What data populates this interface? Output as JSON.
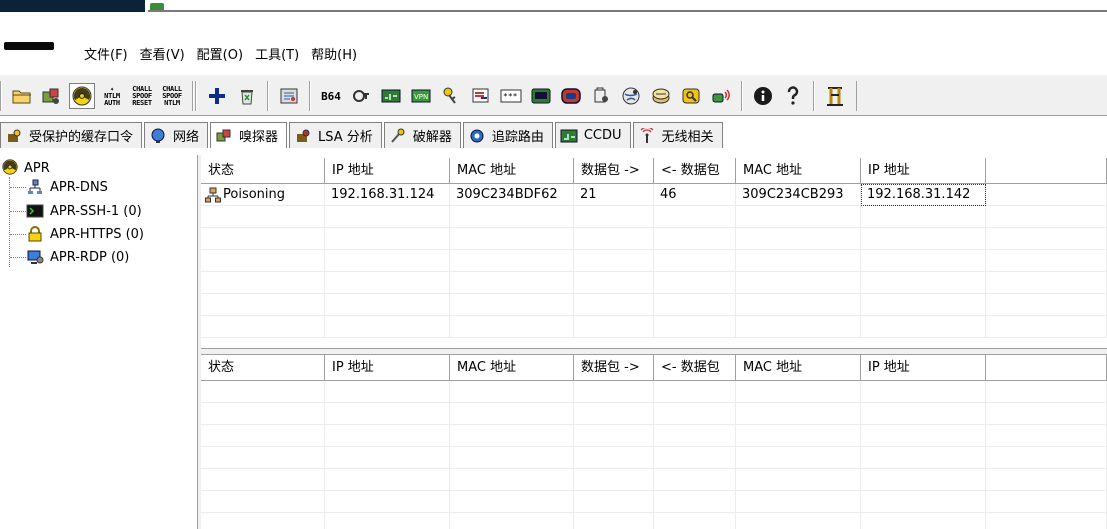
{
  "menu": {
    "items": [
      {
        "label": "文件(F)"
      },
      {
        "label": "查看(V)"
      },
      {
        "label": "配置(O)"
      },
      {
        "label": "工具(T)"
      },
      {
        "label": "帮助(H)"
      }
    ]
  },
  "toolbar": {
    "ntlm_auth": [
      "NTLM",
      "AUTH"
    ],
    "chall_spoof_reset": [
      "CHALL",
      "SPOOF",
      "RESET"
    ],
    "chall_spoof_ntlm": [
      "CHALL",
      "SPOOF",
      "NTLM"
    ],
    "b64": "B64"
  },
  "tabs": [
    {
      "label": "受保护的缓存口令",
      "icon": "key-icon"
    },
    {
      "label": "网络",
      "icon": "network-icon"
    },
    {
      "label": "嗅探器",
      "icon": "sniffer-icon",
      "active": true
    },
    {
      "label": "LSA 分析",
      "icon": "lsa-icon"
    },
    {
      "label": "破解器",
      "icon": "cracker-icon"
    },
    {
      "label": "追踪路由",
      "icon": "traceroute-icon"
    },
    {
      "label": "CCDU",
      "icon": "ccdu-icon"
    },
    {
      "label": "无线相关",
      "icon": "wireless-icon"
    }
  ],
  "tree": {
    "root": "APR",
    "children": [
      {
        "label": "APR-DNS",
        "icon": "dns-icon"
      },
      {
        "label": "APR-SSH-1 (0)",
        "icon": "terminal-icon"
      },
      {
        "label": "APR-HTTPS (0)",
        "icon": "lock-icon"
      },
      {
        "label": "APR-RDP (0)",
        "icon": "rdp-icon"
      }
    ]
  },
  "grid_top": {
    "columns": [
      "状态",
      "IP 地址",
      "MAC 地址",
      "数据包 ->",
      "<- 数据包",
      "MAC 地址",
      "IP 地址"
    ],
    "rows": [
      {
        "status": "Poisoning",
        "ip1": "192.168.31.124",
        "mac1": "309C234BDF62",
        "pkt_out": "21",
        "pkt_in": "46",
        "mac2": "309C234CB293",
        "ip2": "192.168.31.142"
      }
    ]
  },
  "grid_bottom": {
    "columns": [
      "状态",
      "IP 地址",
      "MAC 地址",
      "数据包 ->",
      "<- 数据包",
      "MAC 地址",
      "IP 地址"
    ],
    "rows": []
  }
}
